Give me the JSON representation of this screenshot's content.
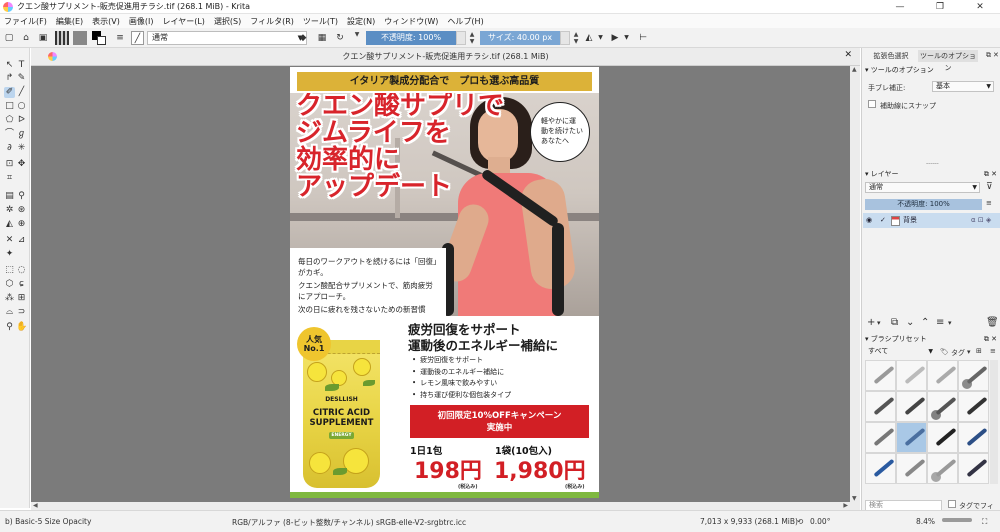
{
  "window": {
    "title": "クエン酸サプリメント-販売促進用チラシ.tif (268.1 MiB) - Krita",
    "controls": {
      "minimize": "—",
      "maximize": "❐",
      "close": "✕"
    }
  },
  "menu": [
    "ファイル(F)",
    "編集(E)",
    "表示(V)",
    "画像(I)",
    "レイヤー(L)",
    "選択(S)",
    "フィルタ(R)",
    "ツール(T)",
    "設定(N)",
    "ウィンドウ(W)",
    "ヘルプ(H)"
  ],
  "toolbar": {
    "blend_mode": "通常",
    "opacity": "不透明度: 100%",
    "size": "サイズ: 40.00 px"
  },
  "document": {
    "tab_title": "クエン酸サプリメント-販売促進用チラシ.tif (268.1 MiB)"
  },
  "flyer": {
    "banner": "イタリア製成分配合で　プロも選ぶ高品質",
    "headline": [
      "クエン酸サプリで",
      "ジムライフを",
      "効率的に",
      "アップデート"
    ],
    "bubble": [
      "軽やかに運",
      "動を続けたい",
      "あなたへ"
    ],
    "info": [
      "毎日のワークアウトを続けるには「回復」がカギ。",
      "クエン酸配合サプリメントで、筋肉疲労にアプローチ。",
      "次の日に疲れを残さないための新習慣を、今日から。"
    ],
    "badge": [
      "人気",
      "No.1"
    ],
    "pouch": {
      "brand": "DESLLISH",
      "product": [
        "CITRIC ACID",
        "SUPPLEMENT"
      ],
      "tag": "ENERGY"
    },
    "subhead": [
      "疲労回復をサポート",
      "運動後のエネルギー補給に"
    ],
    "bullets": [
      "疲労回復をサポート",
      "運動後のエネルギー補給に",
      "レモン風味で飲みやすい",
      "持ち運び便利な個包装タイプ"
    ],
    "cta": [
      "初回限定10%OFFキャンペーン",
      "実施中"
    ],
    "price1_label": "1日1包",
    "price1": "198円",
    "price2_label": "1袋(10包入)",
    "price2": "1,980円",
    "tax_note": "(税込み)"
  },
  "right_panel": {
    "tabs": [
      "拡張色選択",
      "ツールのオプション"
    ],
    "tool_options_title": "ツールのオプション",
    "smoothing_label": "手ブレ補正:",
    "smoothing_value": "基本",
    "snap_label": "補助線にスナップ",
    "layers_title": "レイヤー",
    "layer_blend": "通常",
    "layer_opacity": "不透明度: 100%",
    "layer_name": "背景",
    "brush_title": "ブラシプリセット",
    "brush_filter": "すべて",
    "brush_tag": "タグ",
    "search_placeholder": "検索",
    "tag_filter_label": "タグでフィルタ"
  },
  "status": {
    "brush": "b) Basic-5 Size Opacity",
    "color": "RGB/アルファ (8-ビット整数/チャンネル)  sRGB-elle-V2-srgbtrc.icc",
    "dimensions": "7,013 x 9,933 (268.1 MiB)",
    "rotation": "0.00°",
    "zoom": "8.4%"
  }
}
